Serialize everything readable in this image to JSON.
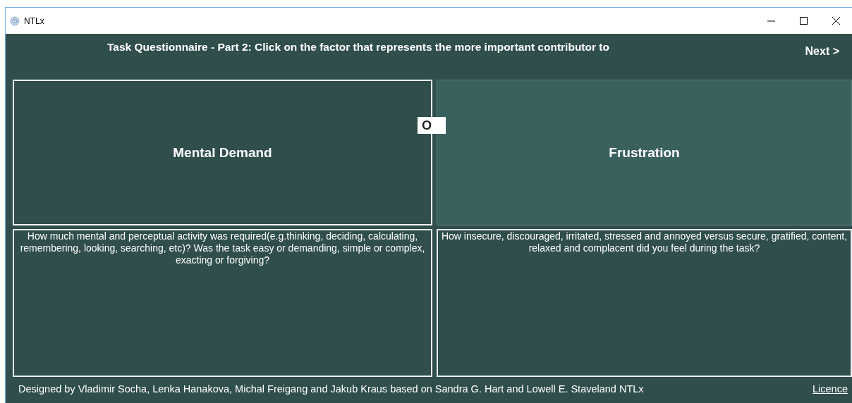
{
  "window": {
    "title": "NTLx"
  },
  "header": {
    "title": "Task Questionnaire - Part 2: Click on the factor that represents the more important contributor to",
    "next": "Next >"
  },
  "factors": [
    {
      "name": "Mental Demand",
      "selected": true,
      "description": "How much mental and perceptual activity was required(e.g.thinking, deciding, calculating, remembering, looking, searching, etc)? Was the task easy or demanding, simple or complex, exacting or forgiving?"
    },
    {
      "name": "Frustration",
      "selected": false,
      "description": "How insecure, discouraged, irritated, stressed and annoyed versus secure, gratified, content, relaxed and complacent did you feel during the task?"
    }
  ],
  "separator_label": "O",
  "footer": {
    "credits": "Designed by Vladimir Socha, Lenka Hanakova, Michal Freigang and Jakub Kraus based on Sandra G. Hart and Lowell E. Staveland NTLx",
    "licence": "Licence"
  }
}
